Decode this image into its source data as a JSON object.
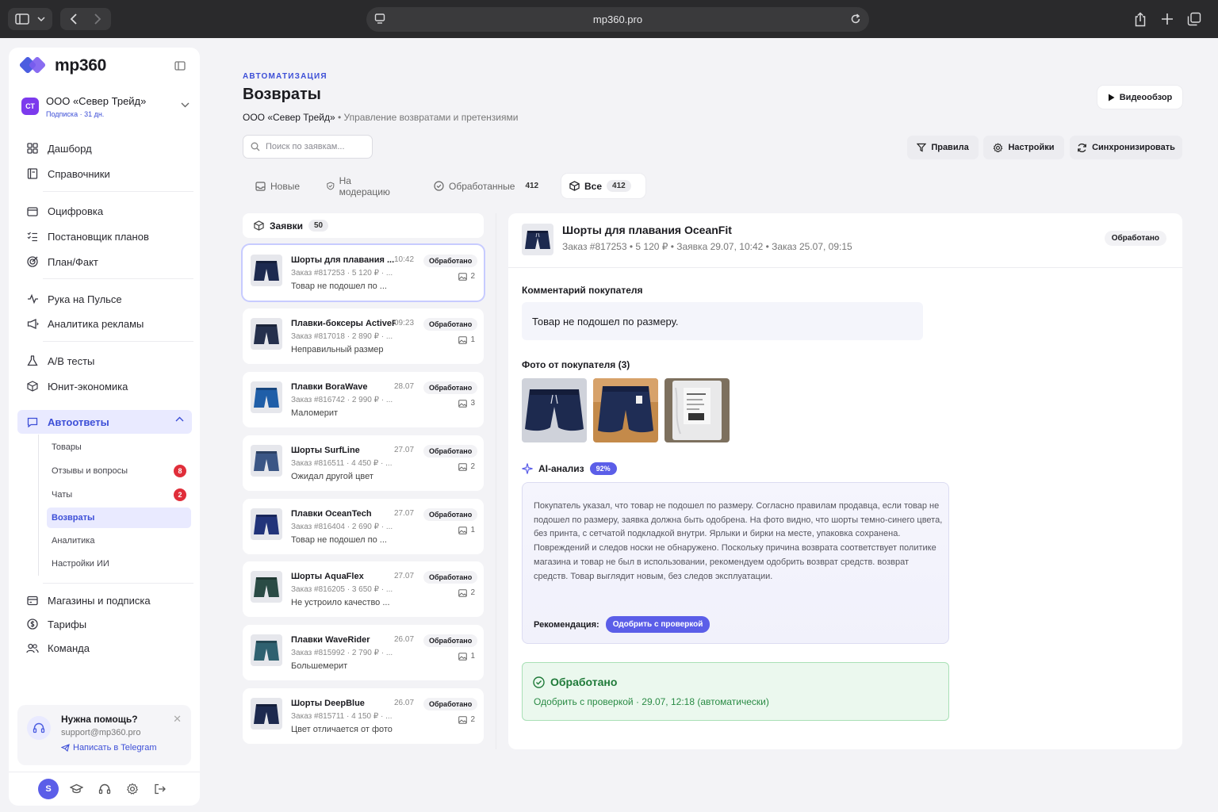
{
  "browser": {
    "url": "mp360.pro"
  },
  "brand": {
    "name": "mp360",
    "accent": "#3d4fd7"
  },
  "org": {
    "initials": "СТ",
    "name": "ООО «Север Трейд»",
    "subscription": "Подписка · 31 дн."
  },
  "nav": {
    "dashboard": "Дашборд",
    "directories": "Справочники",
    "digitization": "Оцифровка",
    "planner": "Постановщик планов",
    "plan_fact": "План/Факт",
    "pulse": "Рука на Пульсе",
    "ad_analytics": "Аналитика рекламы",
    "ab_tests": "A/B тесты",
    "unit_economics": "Юнит-экономика",
    "autoreplies": "Автоответы",
    "stores": "Магазины и подписка",
    "tariffs": "Тарифы",
    "team": "Команда"
  },
  "subnav": {
    "products": "Товары",
    "reviews": "Отзывы и вопросы",
    "reviews_badge": "8",
    "chats": "Чаты",
    "chats_badge": "2",
    "returns": "Возвраты",
    "analytics": "Аналитика",
    "ai_settings": "Настройки ИИ"
  },
  "help": {
    "title": "Нужна помощь?",
    "email": "support@mp360.pro",
    "telegram": "Написать в Telegram"
  },
  "user": {
    "initial": "S"
  },
  "header": {
    "kicker": "АВТОМАТИЗАЦИЯ",
    "title": "Возвраты",
    "org": "ООО «Север Трейд»",
    "sep": "•",
    "subtitle": "Управление возвратами и претензиями",
    "video": "Видеообзор"
  },
  "search": {
    "placeholder": "Поиск по заявкам..."
  },
  "toolbar": {
    "rules": "Правила",
    "settings": "Настройки",
    "sync": "Синхронизировать"
  },
  "tabs": [
    {
      "label": "Новые",
      "count": ""
    },
    {
      "label": "На модерацию",
      "count": ""
    },
    {
      "label": "Обработанные",
      "count": "412"
    },
    {
      "label": "Все",
      "count": "412"
    }
  ],
  "list": {
    "title": "Заявки",
    "count": "50",
    "items": [
      {
        "name": "Шорты для плавания ...",
        "time": "10:42",
        "status": "Обработано",
        "meta": "Заказ #817253 · 5 120 ₽ · ...",
        "reason": "Товар не подошел по ...",
        "photos": "2",
        "color": "#1d2a4f"
      },
      {
        "name": "Плавки-боксеры ActivePro",
        "time": "09:23",
        "status": "Обработано",
        "meta": "Заказ #817018 · 2 890 ₽ · ...",
        "reason": "Неправильный размер",
        "photos": "1",
        "color": "#25304d"
      },
      {
        "name": "Плавки BoraWave",
        "time": "28.07",
        "status": "Обработано",
        "meta": "Заказ #816742 · 2 990 ₽ · ...",
        "reason": "Маломерит",
        "photos": "3",
        "color": "#1f5ea8"
      },
      {
        "name": "Шорты SurfLine",
        "time": "27.07",
        "status": "Обработано",
        "meta": "Заказ #816511 · 4 450 ₽ · ...",
        "reason": "Ожидал другой цвет",
        "photos": "2",
        "color": "#3b5685"
      },
      {
        "name": "Плавки OceanTech",
        "time": "27.07",
        "status": "Обработано",
        "meta": "Заказ #816404 · 2 690 ₽ · ...",
        "reason": "Товар не подошел по ...",
        "photos": "1",
        "color": "#22347a"
      },
      {
        "name": "Шорты AquaFlex",
        "time": "27.07",
        "status": "Обработано",
        "meta": "Заказ #816205 · 3 650 ₽ · ...",
        "reason": "Не устроило качество ...",
        "photos": "2",
        "color": "#2a4b45"
      },
      {
        "name": "Плавки WaveRider",
        "time": "26.07",
        "status": "Обработано",
        "meta": "Заказ #815992 · 2 790 ₽ · ...",
        "reason": "Большемерит",
        "photos": "1",
        "color": "#2f6170"
      },
      {
        "name": "Шорты DeepBlue",
        "time": "26.07",
        "status": "Обработано",
        "meta": "Заказ #815711 · 4 150 ₽ · ...",
        "reason": "Цвет отличается от фото",
        "photos": "2",
        "color": "#1d2a4f"
      }
    ]
  },
  "detail": {
    "title": "Шорты для плавания OceanFit",
    "meta": "Заказ #817253 • 5 120 ₽ • Заявка 29.07, 10:42 • Заказ 25.07, 09:15",
    "status": "Обработано",
    "comment_label": "Комментарий покупателя",
    "comment": "Товар не подошел по размеру.",
    "photos_label": "Фото от покупателя (3)",
    "ai_label": "AI-анализ",
    "ai_pct": "92%",
    "ai_text": "Покупатель указал, что товар не подошел по размеру. Согласно правилам продавца, если товар не подошел по размеру, заявка должна быть одобрена. На фото видно, что шорты темно-синего цвета, без принта, с сетчатой подкладкой внутри. Ярлыки и бирки на месте, упаковка сохранена. Повреждений и следов носки не обнаружено. Поскольку причина возврата соответствует политике магазина и товар не был в использовании, рекомендуем одобрить возврат средств. возврат средств. Товар выглядит новым, без следов эксплуатации.",
    "rec_label": "Рекомендация:",
    "rec_value": "Одобрить с проверкой",
    "done_title": "Обработано",
    "done_sub": "Одобрить с проверкой · 29.07, 12:18 (автоматически)"
  }
}
